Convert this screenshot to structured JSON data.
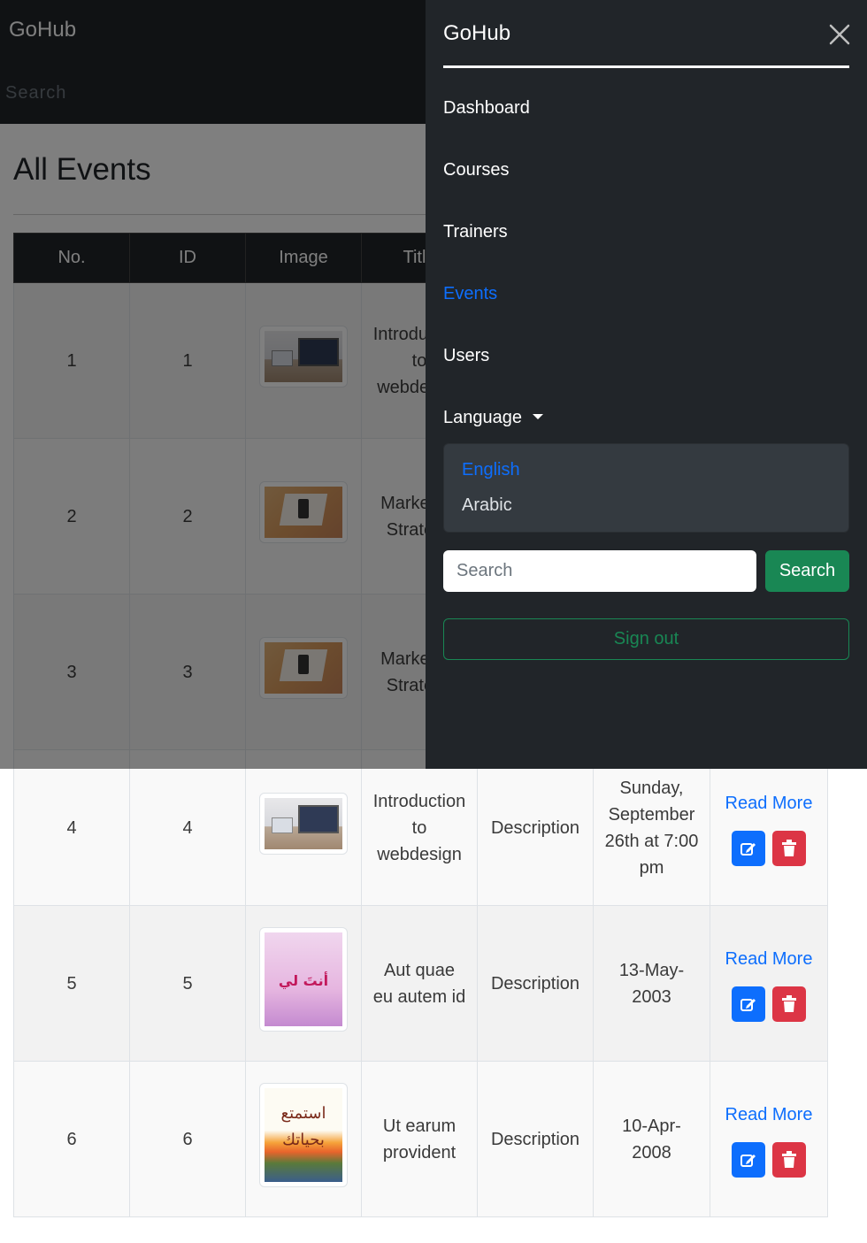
{
  "navbar": {
    "brand": "GoHub",
    "search_placeholder": "Search"
  },
  "page": {
    "title": "All Events"
  },
  "table": {
    "headers": [
      "No.",
      "ID",
      "Image",
      "Title"
    ],
    "rows": [
      {
        "no": "1",
        "id": "1",
        "image": "desk",
        "title": "Introduction to webdesign"
      },
      {
        "no": "2",
        "id": "2",
        "image": "market",
        "title": "Marketing Strategy"
      },
      {
        "no": "3",
        "id": "3",
        "image": "market",
        "title": "Marketing Strategy"
      },
      {
        "no": "4",
        "id": "4",
        "image": "desk",
        "title": "Introduction to webdesign",
        "description": "Description",
        "date": "Sunday, September 26th at 7:00 pm",
        "read_more": "Read More"
      },
      {
        "no": "5",
        "id": "5",
        "image": "book-pink",
        "book_text": "أنتَ لي",
        "title": "Aut quae eu autem id",
        "description": "Description",
        "date": "13-May-2003",
        "read_more": "Read More"
      },
      {
        "no": "6",
        "id": "6",
        "image": "book-sunset",
        "book_text": "استمتع بحياتك",
        "title": "Ut earum provident",
        "description": "Description",
        "date": "10-Apr-2008",
        "read_more": "Read More"
      }
    ]
  },
  "offcanvas": {
    "title": "GoHub",
    "nav": [
      {
        "label": "Dashboard",
        "active": false
      },
      {
        "label": "Courses",
        "active": false
      },
      {
        "label": "Trainers",
        "active": false
      },
      {
        "label": "Events",
        "active": true
      },
      {
        "label": "Users",
        "active": false
      }
    ],
    "language_label": "Language",
    "languages": [
      {
        "label": "English",
        "active": true
      },
      {
        "label": "Arabic",
        "active": false
      }
    ],
    "search_placeholder": "Search",
    "search_button": "Search",
    "signout": "Sign out"
  },
  "colors": {
    "dark": "#212529",
    "primary": "#0d6efd",
    "success": "#198754",
    "danger": "#dc3545"
  }
}
